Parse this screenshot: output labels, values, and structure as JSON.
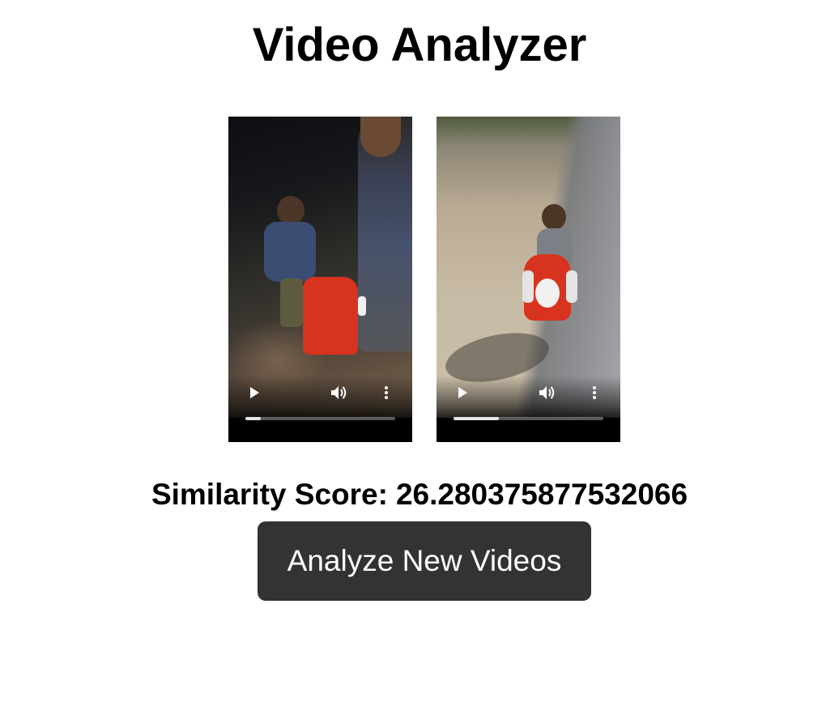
{
  "page": {
    "title": "Video Analyzer"
  },
  "videos": [
    {
      "scene": "night",
      "controls": {
        "play_icon": "play-icon",
        "volume_icon": "volume-icon",
        "more_icon": "more-vertical-icon",
        "progress_fraction": 0.1
      }
    },
    {
      "scene": "day",
      "controls": {
        "play_icon": "play-icon",
        "volume_icon": "volume-icon",
        "more_icon": "more-vertical-icon",
        "progress_fraction": 0.3
      }
    }
  ],
  "result": {
    "label": "Similarity Score:",
    "value": "26.280375877532066"
  },
  "actions": {
    "analyze_label": "Analyze New Videos"
  },
  "colors": {
    "button_bg": "#333333",
    "button_text": "#ffffff",
    "page_bg": "#ffffff",
    "text": "#000000"
  }
}
